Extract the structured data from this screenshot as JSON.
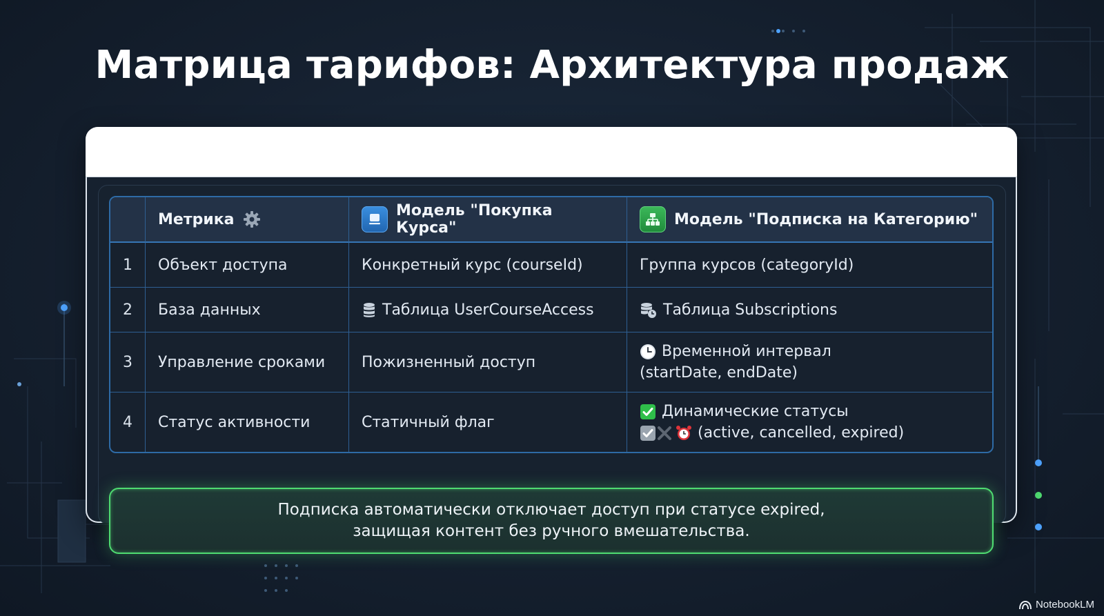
{
  "title": "Матрица тарифов: Архитектура продаж",
  "table": {
    "headers": {
      "metric": "Метрика",
      "course": "Модель \"Покупка Курса\"",
      "category": "Модель \"Подписка на Категорию\""
    },
    "header_icons": {
      "metric": "gear-icon",
      "course": "monitor-icon",
      "category": "hierarchy-icon"
    },
    "rows": [
      {
        "num": "1",
        "metric": "Объект доступа",
        "course": "Конкретный курс (courseId)",
        "category": [
          "Группа курсов (categoryId)"
        ]
      },
      {
        "num": "2",
        "metric": "База данных",
        "course": "Таблица UserCourseAccess",
        "category": [
          "Таблица Subscriptions"
        ]
      },
      {
        "num": "3",
        "metric": "Управление сроками",
        "course": "Пожизненный доступ",
        "category": [
          "Временной интервал",
          "(startDate, endDate)"
        ]
      },
      {
        "num": "4",
        "metric": "Статус активности",
        "course": "Статичный флаг",
        "category": [
          "Динамические статусы",
          "(active, cancelled, expired)"
        ]
      }
    ]
  },
  "callout": {
    "line1": "Подписка автоматически отключает доступ при статусе expired,",
    "line2": "защищая контент без ручного вмешательства."
  },
  "watermark": "NotebookLM",
  "colors": {
    "background": "#15202f",
    "table_border": "#2e6ba6",
    "callout_border": "#4fdc71",
    "course_badge": "#2f7fd0",
    "category_badge": "#2fa34b"
  }
}
